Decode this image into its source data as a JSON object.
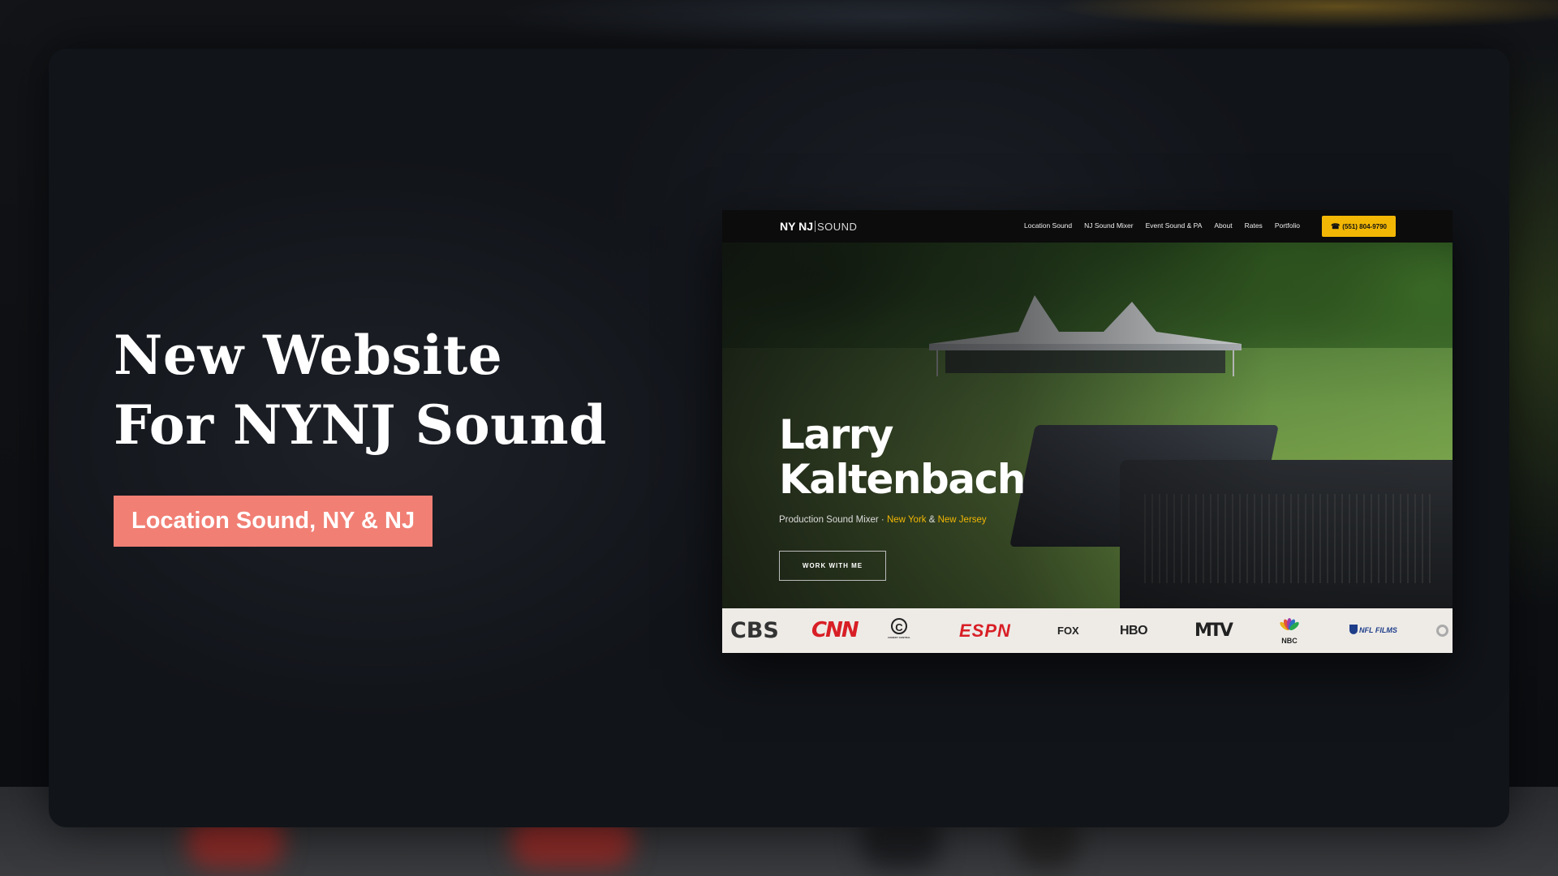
{
  "headline": {
    "line1": "New Website",
    "line2": "For NYNJ Sound"
  },
  "tag": "Location Sound, NY & NJ",
  "site": {
    "logo_bold": "NY NJ",
    "logo_light": "SOUND",
    "nav": [
      "Location Sound",
      "NJ Sound Mixer",
      "Event Sound & PA",
      "About",
      "Rates",
      "Portfolio"
    ],
    "phone": "(551) 804-9790",
    "phone_icon": "phone-icon",
    "hero_name_1": "Larry",
    "hero_name_2": "Kaltenbach",
    "hero_sub_prefix": "Production Sound Mixer · ",
    "hero_sub_ny": "New York",
    "hero_sub_amp": " & ",
    "hero_sub_nj": "New Jersey",
    "cta": "WORK WITH ME",
    "brands": [
      "CBS",
      "CNN",
      "COMEDY CENTRAL",
      "ESPN",
      "FOX",
      "HBO",
      "MTV",
      "NBC",
      "NFL FILMS"
    ]
  },
  "colors": {
    "accent": "#f17f74",
    "yellow": "#f2b705",
    "card_bg": "#111419"
  }
}
